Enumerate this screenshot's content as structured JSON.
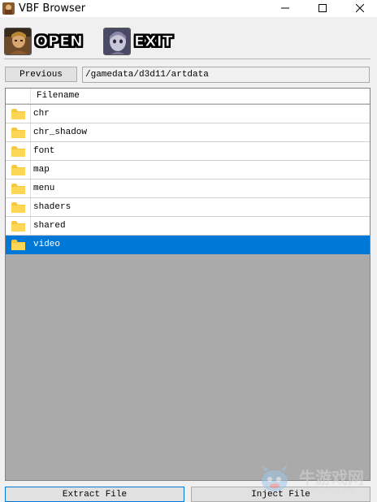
{
  "window": {
    "title": "VBF Browser",
    "icons": {
      "app": "portrait-app-icon",
      "minimize": "minimize-icon",
      "maximize": "maximize-icon",
      "close": "close-icon"
    }
  },
  "toolbar": {
    "open_label": "OPEN",
    "exit_label": "EXIT",
    "open_icon": "character-portrait-icon",
    "exit_icon": "ghost-portrait-icon"
  },
  "nav": {
    "previous_label": "Previous",
    "current_path": "/gamedata/d3d11/artdata"
  },
  "list": {
    "columns": [
      "Filename"
    ],
    "items": [
      {
        "name": "chr",
        "type": "folder",
        "selected": false
      },
      {
        "name": "chr_shadow",
        "type": "folder",
        "selected": false
      },
      {
        "name": "font",
        "type": "folder",
        "selected": false
      },
      {
        "name": "map",
        "type": "folder",
        "selected": false
      },
      {
        "name": "menu",
        "type": "folder",
        "selected": false
      },
      {
        "name": "shaders",
        "type": "folder",
        "selected": false
      },
      {
        "name": "shared",
        "type": "folder",
        "selected": false
      },
      {
        "name": "video",
        "type": "folder",
        "selected": true
      }
    ]
  },
  "actions": {
    "extract_label": "Extract File",
    "inject_label": "Inject File"
  },
  "watermark": {
    "text": "牛游戏网",
    "url": "www.newyx.net"
  },
  "colors": {
    "selection": "#0078d7",
    "folder": "#f8c73c",
    "list_background": "#aaaaaa"
  }
}
